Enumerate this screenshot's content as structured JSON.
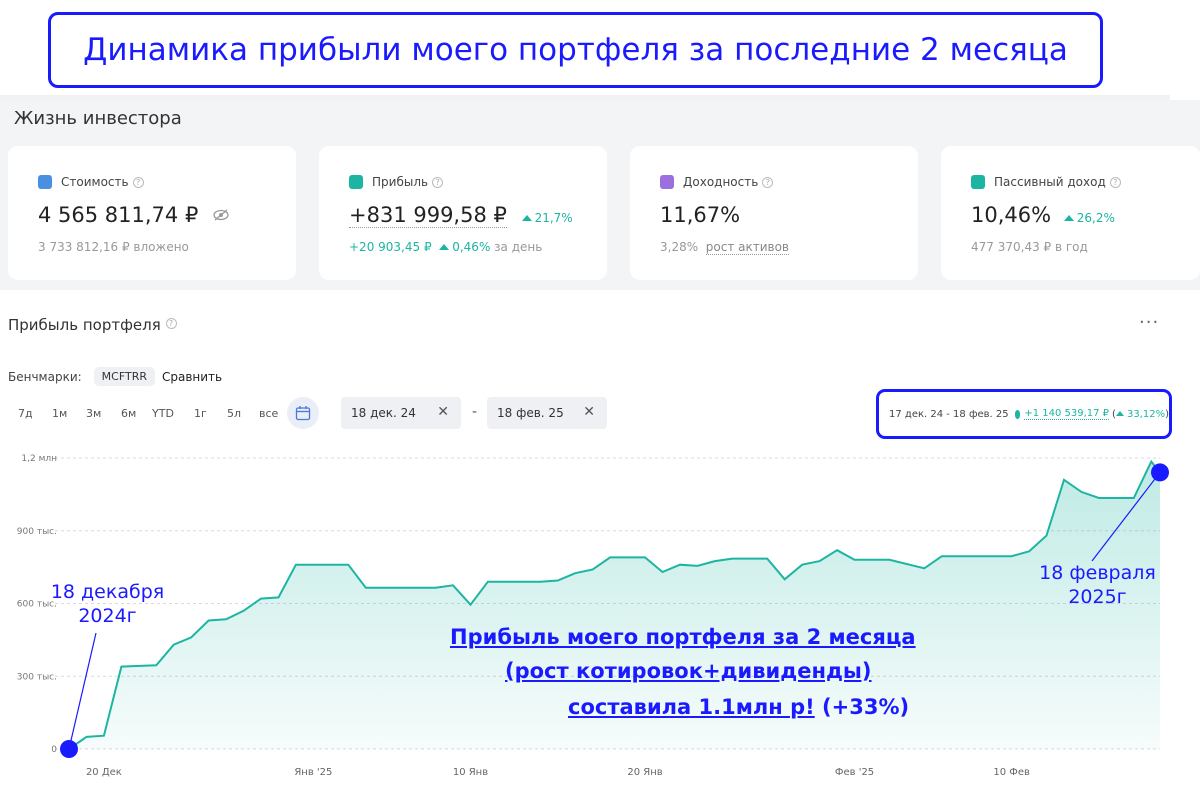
{
  "banner": {
    "title": "Динамика прибыли моего портфеля за последние 2 месяца"
  },
  "dashboard": {
    "title": "Жизнь инвестора",
    "cards": [
      {
        "label": "Стоимость",
        "value": "4 565 811,74 ₽",
        "sub": "3 733 812,16 ₽ вложено",
        "icon": "wallet-icon",
        "icon_color": "#4a90e2"
      },
      {
        "label": "Прибыль",
        "value": "+831 999,58 ₽",
        "change": "21,7%",
        "sub_value": "+20 903,45 ₽",
        "sub_change": "0,46%",
        "sub_suffix": "за день",
        "icon": "chart-icon",
        "icon_color": "#1cb5a2"
      },
      {
        "label": "Доходность",
        "value": "11,67%",
        "sub_value": "3,28%",
        "sub_link": "рост активов",
        "icon": "calendar-icon",
        "icon_color": "#9b6fe0"
      },
      {
        "label": "Пассивный доход",
        "value": "10,46%",
        "change": "26,2%",
        "sub": "477 370,43 ₽ в год",
        "icon": "piggy-icon",
        "icon_color": "#1cb5a2"
      }
    ]
  },
  "portfolio": {
    "title": "Прибыль портфеля",
    "more": "···",
    "benchmarks_label": "Бенчмарки:",
    "benchmark_chip": "MCFTRR",
    "compare": "Сравнить",
    "periods": [
      "7д",
      "1м",
      "3м",
      "6м",
      "YTD",
      "1г",
      "5л",
      "все"
    ],
    "date_from": "18 дек. 24",
    "date_to": "18 фев. 25",
    "date_sep": "-",
    "summary": {
      "range": "17 дек. 24 - 18 фев. 25",
      "value": "+1 140 539,17 ₽",
      "pct": "33,12%"
    }
  },
  "annotations": {
    "start": [
      "18 декабря",
      "2024г"
    ],
    "end": [
      "18 февраля",
      "2025г"
    ],
    "message_line1": "Прибыль моего портфеля за 2 месяца",
    "message_line2": "(рост котировок+дивиденды)",
    "message_line3": "составила 1.1млн р!",
    "message_tail": "(+33%)"
  },
  "colors": {
    "accent": "#1cb5a2",
    "annotation": "#1a1aff"
  },
  "chart_data": {
    "type": "area",
    "y_ticks": [
      {
        "v": 0,
        "label": "0"
      },
      {
        "v": 300000,
        "label": "300 тыс."
      },
      {
        "v": 600000,
        "label": "600 тыс."
      },
      {
        "v": 900000,
        "label": "900 тыс."
      },
      {
        "v": 1200000,
        "label": "1,2 млн"
      }
    ],
    "x_ticks": [
      {
        "x": "2024-12-20",
        "label": "20 Дек"
      },
      {
        "x": "2025-01-01",
        "label": "Янв '25"
      },
      {
        "x": "2025-01-10",
        "label": "10 Янв"
      },
      {
        "x": "2025-01-20",
        "label": "20 Янв"
      },
      {
        "x": "2025-02-01",
        "label": "Фев '25"
      },
      {
        "x": "2025-02-10",
        "label": "10 Фев"
      }
    ],
    "ylim": [
      0,
      1200000
    ],
    "xlim": [
      "2024-12-18",
      "2025-02-18"
    ],
    "series": [
      {
        "points": [
          [
            "2024-12-18",
            0
          ],
          [
            "2024-12-19",
            50000
          ],
          [
            "2024-12-20",
            55000
          ],
          [
            "2024-12-21",
            340000
          ],
          [
            "2024-12-23",
            345000
          ],
          [
            "2024-12-24",
            430000
          ],
          [
            "2024-12-25",
            460000
          ],
          [
            "2024-12-26",
            530000
          ],
          [
            "2024-12-27",
            535000
          ],
          [
            "2024-12-28",
            570000
          ],
          [
            "2024-12-29",
            620000
          ],
          [
            "2024-12-30",
            625000
          ],
          [
            "2024-12-31",
            760000
          ],
          [
            "2025-01-03",
            760000
          ],
          [
            "2025-01-04",
            665000
          ],
          [
            "2025-01-08",
            665000
          ],
          [
            "2025-01-09",
            675000
          ],
          [
            "2025-01-10",
            595000
          ],
          [
            "2025-01-11",
            690000
          ],
          [
            "2025-01-14",
            690000
          ],
          [
            "2025-01-15",
            695000
          ],
          [
            "2025-01-16",
            725000
          ],
          [
            "2025-01-17",
            740000
          ],
          [
            "2025-01-18",
            790000
          ],
          [
            "2025-01-20",
            790000
          ],
          [
            "2025-01-21",
            730000
          ],
          [
            "2025-01-22",
            760000
          ],
          [
            "2025-01-23",
            755000
          ],
          [
            "2025-01-24",
            775000
          ],
          [
            "2025-01-25",
            785000
          ],
          [
            "2025-01-27",
            785000
          ],
          [
            "2025-01-28",
            700000
          ],
          [
            "2025-01-29",
            760000
          ],
          [
            "2025-01-30",
            775000
          ],
          [
            "2025-01-31",
            820000
          ],
          [
            "2025-02-01",
            780000
          ],
          [
            "2025-02-03",
            780000
          ],
          [
            "2025-02-05",
            745000
          ],
          [
            "2025-02-06",
            795000
          ],
          [
            "2025-02-10",
            795000
          ],
          [
            "2025-02-11",
            815000
          ],
          [
            "2025-02-12",
            880000
          ],
          [
            "2025-02-13",
            1110000
          ],
          [
            "2025-02-14",
            1060000
          ],
          [
            "2025-02-15",
            1035000
          ],
          [
            "2025-02-17",
            1035000
          ],
          [
            "2025-02-18",
            1185000
          ],
          [
            "2025-02-18T12:00",
            1140539
          ]
        ]
      }
    ]
  }
}
